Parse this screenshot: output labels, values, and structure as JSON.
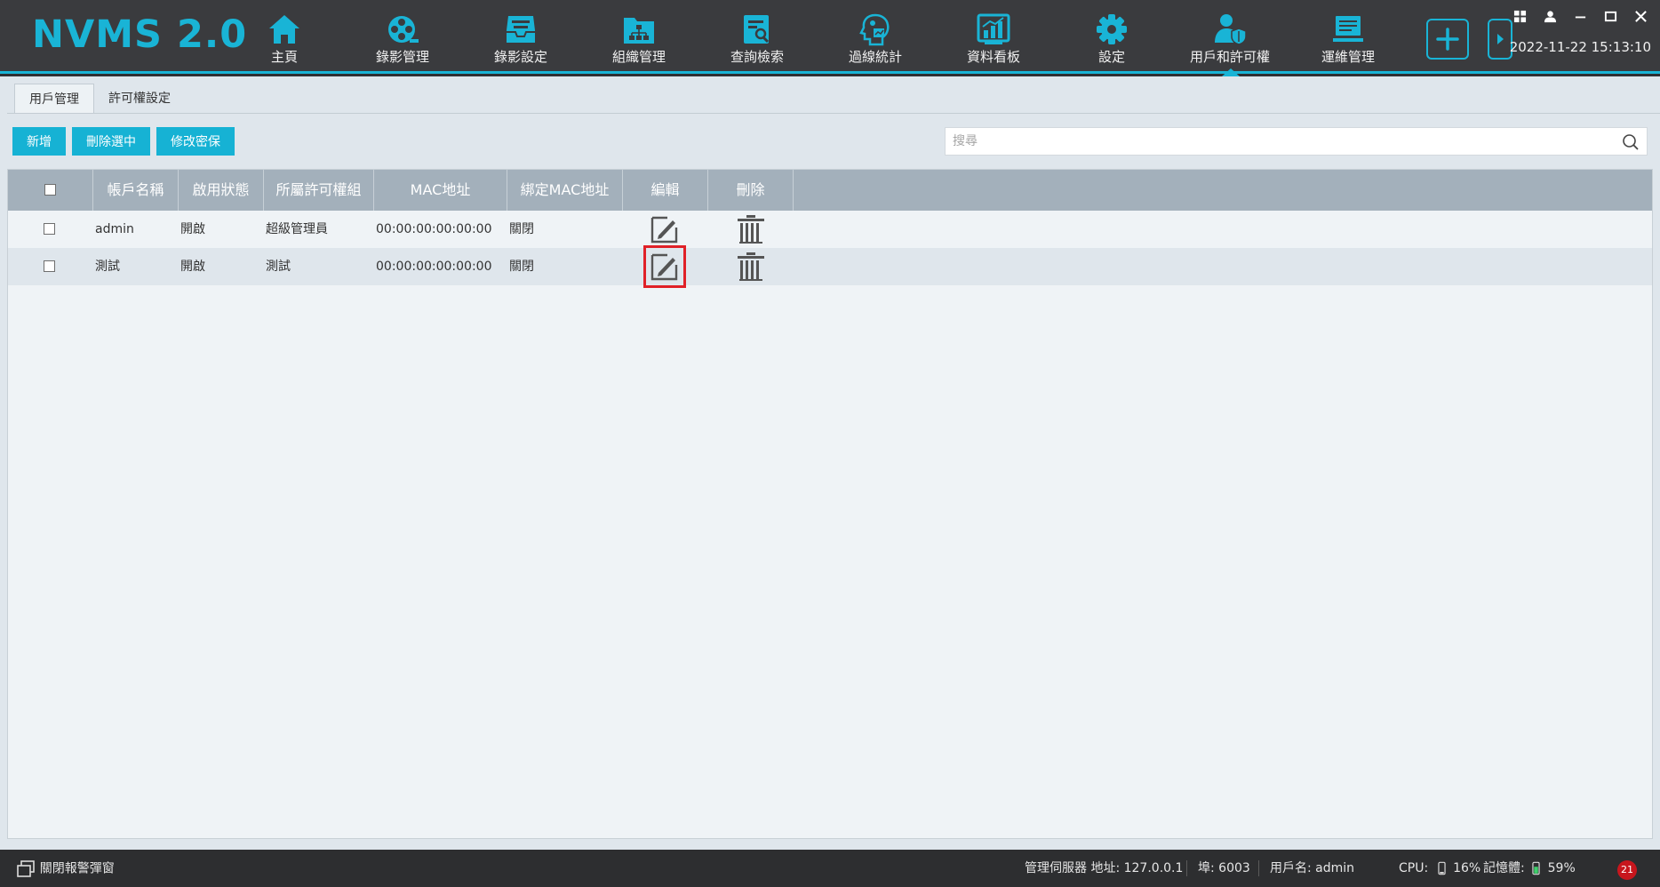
{
  "app": {
    "logo": "NVMS 2.0",
    "datetime": "2022-11-22 15:13:10"
  },
  "nav": {
    "items": [
      {
        "label": "主頁",
        "icon": "home-icon"
      },
      {
        "label": "錄影管理",
        "icon": "film-reel-icon"
      },
      {
        "label": "錄影設定",
        "icon": "inbox-tray-icon"
      },
      {
        "label": "組織管理",
        "icon": "org-folder-icon"
      },
      {
        "label": "查詢檢索",
        "icon": "document-search-icon"
      },
      {
        "label": "過線統計",
        "icon": "head-analytics-icon"
      },
      {
        "label": "資料看板",
        "icon": "bar-chart-board-icon"
      },
      {
        "label": "設定",
        "icon": "gear-icon"
      },
      {
        "label": "用戶和許可權",
        "icon": "user-shield-icon"
      },
      {
        "label": "運維管理",
        "icon": "monitor-maintenance-icon"
      }
    ],
    "active_index": 8
  },
  "tabs": [
    {
      "label": "用戶管理",
      "active": true
    },
    {
      "label": "許可權設定",
      "active": false
    }
  ],
  "toolbar": {
    "add_label": "新增",
    "delete_selected_label": "刪除選中",
    "change_security_label": "修改密保",
    "search_placeholder": "搜尋"
  },
  "table": {
    "headers": {
      "account": "帳戶名稱",
      "status": "啟用狀態",
      "group": "所屬許可權組",
      "mac": "MAC地址",
      "bind_mac": "綁定MAC地址",
      "edit": "編輯",
      "delete": "刪除"
    },
    "rows": [
      {
        "account": "admin",
        "status": "開啟",
        "group": "超級管理員",
        "mac": "00:00:00:00:00:00",
        "bind_mac": "關閉"
      },
      {
        "account": "測試",
        "status": "開啟",
        "group": "測試",
        "mac": "00:00:00:00:00:00",
        "bind_mac": "關閉"
      }
    ]
  },
  "status_bar": {
    "alarm_popup_label": "關閉報警彈窗",
    "server": "管理伺服器 地址: 127.0.0.1",
    "port": "埠: 6003",
    "user": "用戶名: admin",
    "cpu_label": "CPU:",
    "cpu_value": "16%",
    "memory_label": "記憶體:",
    "memory_value": "59%",
    "alarm_count": "21"
  },
  "colors": {
    "accent": "#19b4d6",
    "topbar": "#3a3b3e",
    "highlight": "#e02027"
  }
}
